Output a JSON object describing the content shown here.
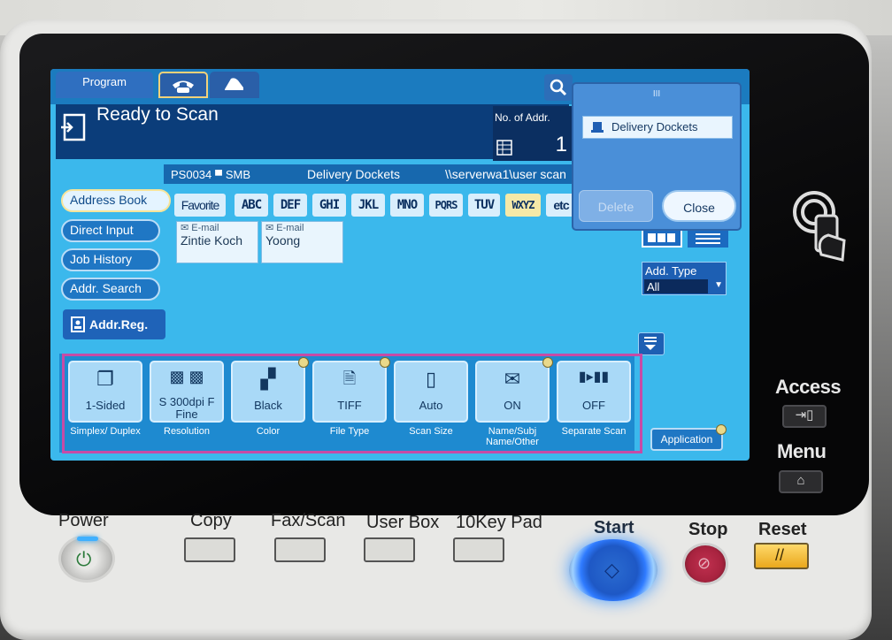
{
  "screen": {
    "tabs": {
      "program": "Program"
    },
    "status": {
      "title": "Ready to Scan",
      "addr_label": "No. of Addr.",
      "addr_count": "1"
    },
    "pathbar": {
      "id": "PS0034",
      "protocol": "SMB",
      "name": "Delivery Dockets",
      "path": "\\\\serverwa1\\user scan"
    },
    "leftnav": [
      {
        "label": "Address Book"
      },
      {
        "label": "Direct Input"
      },
      {
        "label": "Job History"
      },
      {
        "label": "Addr. Search"
      }
    ],
    "addr_reg": "Addr.Reg.",
    "index_tabs": [
      "Favorite",
      "ABC",
      "DEF",
      "GHI",
      "JKL",
      "MNO",
      "PQRS",
      "TUV",
      "WXYZ",
      "etc"
    ],
    "contacts": [
      {
        "type": "E-mail",
        "name": "Zintie Koch"
      },
      {
        "type": "E-mail",
        "name": "Yoong"
      }
    ],
    "add_type": {
      "label": "Add. Type",
      "value": "All"
    },
    "popup": {
      "handle": "III",
      "item": "Delivery Dockets",
      "delete": "Delete",
      "close": "Close"
    },
    "scan_settings": [
      {
        "value": "1-Sided",
        "label": "Simplex/ Duplex"
      },
      {
        "value": "S 300dpi F Fine",
        "label": "Resolution"
      },
      {
        "value": "Black",
        "label": "Color"
      },
      {
        "value": "TIFF",
        "label": "File Type"
      },
      {
        "value": "Auto",
        "label": "Scan Size"
      },
      {
        "value": "ON",
        "label": "Name/Subj Name/Other"
      },
      {
        "value": "OFF",
        "label": "Separate Scan"
      }
    ],
    "application": "Application"
  },
  "hardware": {
    "side": {
      "access": "Access",
      "menu": "Menu"
    },
    "power": "Power",
    "modes": [
      "Copy",
      "Fax/Scan",
      "User Box",
      "10Key Pad"
    ],
    "start": "Start",
    "stop": "Stop",
    "reset": "Reset"
  },
  "colors": {
    "screen_bg": "#3bb8ec",
    "highlight": "#c64ba6",
    "start_glow": "#2f7bff"
  }
}
